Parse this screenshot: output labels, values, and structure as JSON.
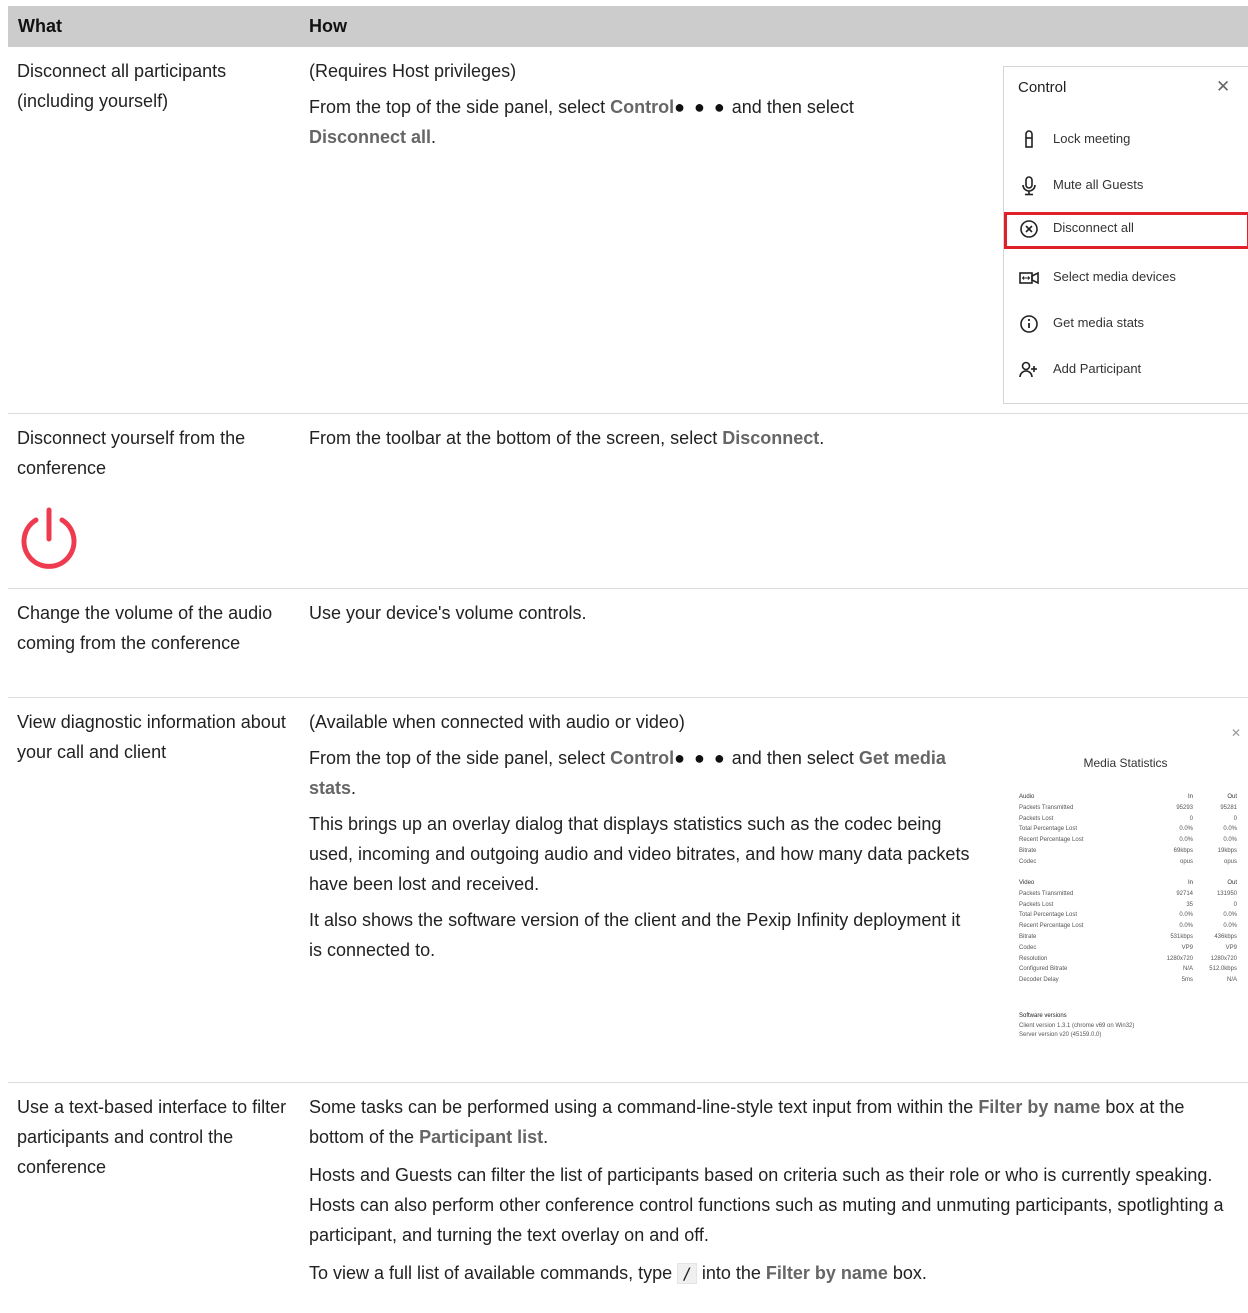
{
  "header": {
    "what": "What",
    "how": "How"
  },
  "rows": [
    {
      "what": "Disconnect all participants (including yourself)",
      "how_p1": "(Requires Host privileges)",
      "how_p2_a": "From the top of the side panel, select ",
      "how_p2_b": "Control",
      "how_p2_dots": "● ● ●",
      "how_p2_c": " and then select ",
      "how_p2_d": "Disconnect all",
      "how_p2_e": "."
    },
    {
      "what": "Disconnect yourself from the conference",
      "how_a": "From the toolbar at the bottom of the screen, select ",
      "how_b": "Disconnect",
      "how_c": "."
    },
    {
      "what": "Change the volume of the audio coming from the conference",
      "how": "Use your device's volume controls."
    },
    {
      "what": "View diagnostic information about your call and client",
      "how_p1": "(Available when connected with audio or video)",
      "how_p2_a": "From the top of the side panel, select ",
      "how_p2_b": "Control",
      "how_p2_dots": "● ● ●",
      "how_p2_c": " and then select ",
      "how_p2_d": "Get media stats",
      "how_p2_e": ".",
      "how_p3": "This brings up an overlay dialog that displays statistics such as the codec being used, incoming and outgoing audio and video bitrates, and how many data packets have been lost and received.",
      "how_p4": "It also shows the software version of the client and the Pexip Infinity deployment it is connected to."
    },
    {
      "what": "Use a text-based interface to filter participants and control the conference",
      "how_p1_a": "Some tasks can be performed using a command-line-style text input from within the ",
      "how_p1_b": "Filter by name",
      "how_p1_c": " box at the bottom of the ",
      "how_p1_d": "Participant list",
      "how_p1_e": ".",
      "how_p2": "Hosts and Guests can filter the list of participants based on criteria such as their role or who is currently speaking. Hosts can also perform other conference control functions such as muting and unmuting participants, spotlighting a participant, and turning the text overlay on and off.",
      "how_p3_a": "To view a full list of available commands, type ",
      "how_p3_code": "/",
      "how_p3_b": " into the ",
      "how_p3_c": "Filter by name",
      "how_p3_d": " box."
    }
  ],
  "control_panel": {
    "title": "Control",
    "close": "✕",
    "items": [
      {
        "label": "Lock meeting",
        "icon": "lock-icon"
      },
      {
        "label": "Mute all Guests",
        "icon": "microphone-icon"
      },
      {
        "label": "Disconnect all",
        "icon": "close-circle-icon",
        "highlighted": true
      },
      {
        "label": "Select media devices",
        "icon": "camera-icon"
      },
      {
        "label": "Get media stats",
        "icon": "info-icon"
      },
      {
        "label": "Add Participant",
        "icon": "add-person-icon"
      }
    ],
    "highlight_color": "#e0212b"
  },
  "power_icon_color": "#ef3b4f",
  "media_stats": {
    "close": "✕",
    "title": "Media Statistics",
    "audio": {
      "head": [
        "Audio",
        "In",
        "Out"
      ],
      "rows": [
        [
          "Packets Transmitted",
          "95293",
          "95281"
        ],
        [
          "Packets Lost",
          "0",
          "0"
        ],
        [
          "Total Percentage Lost",
          "0.0%",
          "0.0%"
        ],
        [
          "Recent Percentage Lost",
          "0.0%",
          "0.0%"
        ],
        [
          "Bitrate",
          "69kbps",
          "19kbps"
        ],
        [
          "Codec",
          "opus",
          "opus"
        ]
      ]
    },
    "video": {
      "head": [
        "Video",
        "In",
        "Out"
      ],
      "rows": [
        [
          "Packets Transmitted",
          "92714",
          "131950"
        ],
        [
          "Packets Lost",
          "35",
          "0"
        ],
        [
          "Total Percentage Lost",
          "0.0%",
          "0.0%"
        ],
        [
          "Recent Percentage Lost",
          "0.0%",
          "0.0%"
        ],
        [
          "Bitrate",
          "531kbps",
          "436kbps"
        ],
        [
          "Codec",
          "VP9",
          "VP9"
        ],
        [
          "Resolution",
          "1280x720",
          "1280x720"
        ],
        [
          "Configured Bitrate",
          "N/A",
          "512.0kbps"
        ],
        [
          "Decoder Delay",
          "5ms",
          "N/A"
        ]
      ]
    },
    "software_title": "Software versions",
    "client_version": "Client version 1.3.1 (chrome v69 on Win32)",
    "server_version": "Server version v20 (45159.0.0)"
  }
}
